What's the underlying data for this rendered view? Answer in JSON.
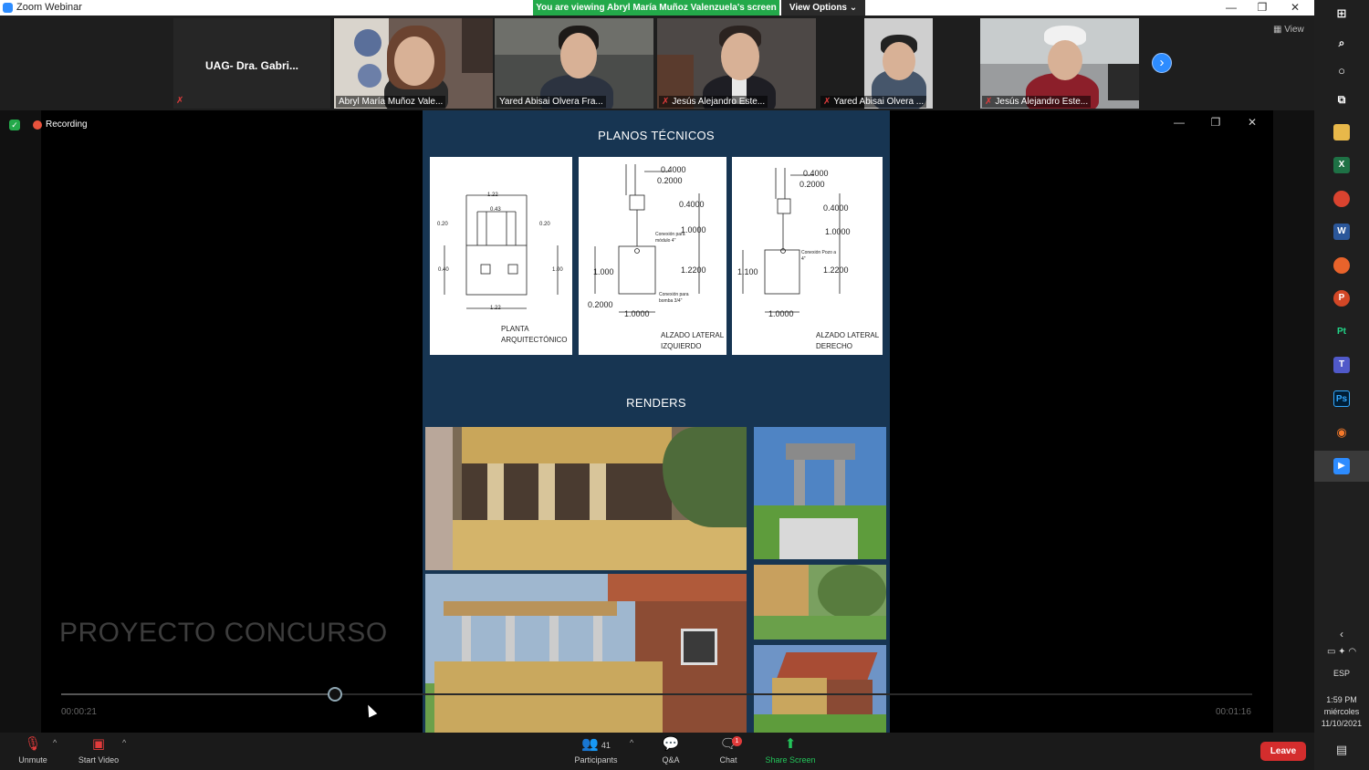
{
  "window": {
    "title": "Zoom Webinar",
    "viewing_banner": "You are viewing Abryl María Muñoz Valenzuela's screen",
    "view_options": "View Options ⌄",
    "minimize": "—",
    "maximize": "❐",
    "close": "✕"
  },
  "participants": {
    "host_label": "UAG- Dra. Gabri...",
    "tiles": [
      {
        "name": "Abryl María Muñoz Vale..."
      },
      {
        "name": "Yared Abisai Olvera Fra..."
      },
      {
        "name": "Jesús Alejandro Este..."
      },
      {
        "name": "Yared Abisai Olvera ..."
      },
      {
        "name": "Jesús Alejandro Este..."
      }
    ],
    "next_arrow": "›",
    "view_label": "▦ View"
  },
  "share": {
    "recording_label": "Recording",
    "window_min": "—",
    "window_restore": "❐",
    "window_close": "✕",
    "project_title": "PROYECTO CONCURSO",
    "time_current": "00:00:21",
    "time_total": "00:01:16",
    "progress_fraction": 0.23
  },
  "slide": {
    "heading_plans": "PLANOS TÉCNICOS",
    "heading_renders": "RENDERS",
    "plan1": {
      "caption": "PLANTA\nARQUITECTÓNICO",
      "dims": [
        "1.22",
        "0.43",
        "0.20",
        "0.20",
        "0.40",
        "1.00",
        "1.22"
      ]
    },
    "plan2": {
      "caption": "ALZADO LATERAL\nIZQUIERDO",
      "dims": [
        "0.4000",
        "0.2000",
        "0.4000",
        "1.0000",
        "1.000",
        "1.2200",
        "0.2000",
        "1.0000"
      ],
      "note1": "Conexión para módulo 4\"",
      "note2": "Conexión para bomba 3/4\""
    },
    "plan3": {
      "caption": "ALZADO LATERAL\nDERECHO",
      "dims": [
        "0.4000",
        "0.2000",
        "0.4000",
        "1.0000",
        "1.100",
        "1.2200",
        "1.0000"
      ],
      "note1": "Conexión Pozo a 4\""
    }
  },
  "toolbar": {
    "unmute": "Unmute",
    "start_video": "Start Video",
    "participants": "Participants",
    "participants_count": "41",
    "qa": "Q&A",
    "chat": "Chat",
    "chat_badge": "1",
    "share_screen": "Share Screen",
    "leave": "Leave"
  },
  "taskbar": {
    "language": "ESP",
    "time": "1:59 PM",
    "day": "miércoles",
    "date": "11/10/2021"
  },
  "colors": {
    "zoom_blue": "#2d8cff",
    "banner_green": "#23a94a",
    "leave_red": "#d42d2d",
    "slide_navy": "#173552"
  }
}
